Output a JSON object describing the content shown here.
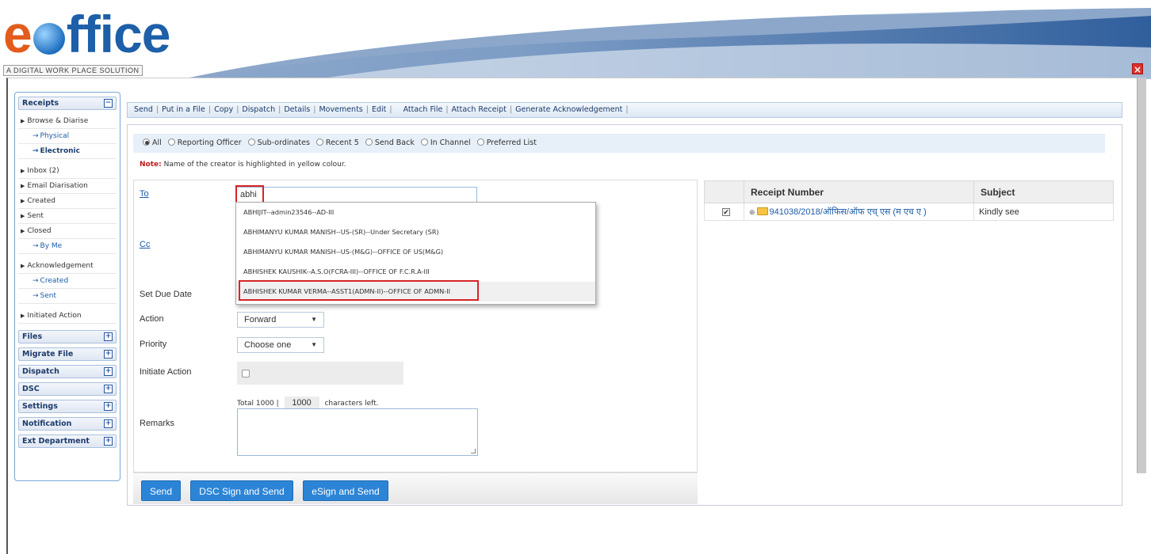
{
  "header": {
    "logo_e": "e",
    "logo_rest": "ffice",
    "tagline": "A DIGITAL WORK PLACE SOLUTION",
    "close": "×"
  },
  "sidebar": {
    "receipts": {
      "title": "Receipts",
      "toggle": "−"
    },
    "receipt_items": [
      {
        "label": "Browse & Diarise",
        "type": "parent"
      },
      {
        "label": "Physical",
        "type": "sub"
      },
      {
        "label": "Electronic",
        "type": "sub-active"
      },
      {
        "label": "Inbox (2)",
        "type": "parent"
      },
      {
        "label": "Email Diarisation",
        "type": "parent"
      },
      {
        "label": "Created",
        "type": "parent"
      },
      {
        "label": "Sent",
        "type": "parent"
      },
      {
        "label": "Closed",
        "type": "parent"
      },
      {
        "label": "By Me",
        "type": "sub"
      },
      {
        "label": "Acknowledgement",
        "type": "parent"
      },
      {
        "label": "Created",
        "type": "sub"
      },
      {
        "label": "Sent",
        "type": "sub"
      },
      {
        "label": "Initiated Action",
        "type": "parent"
      }
    ],
    "sections": [
      "Files",
      "Migrate File",
      "Dispatch",
      "DSC",
      "Settings",
      "Notification",
      "Ext Department"
    ],
    "section_toggle": "+"
  },
  "toolbar": {
    "items": [
      "Send",
      "Put in a File",
      "Copy",
      "Dispatch",
      "Details",
      "Movements",
      "Edit",
      "Attach File",
      "Attach Receipt",
      "Generate Acknowledgement"
    ]
  },
  "filter": {
    "options": [
      "All",
      "Reporting Officer",
      "Sub-ordinates",
      "Recent 5",
      "Send Back",
      "In Channel",
      "Preferred List"
    ],
    "selected": "All",
    "note_label": "Note:",
    "note_text": " Name of the creator is highlighted in yellow colour."
  },
  "form": {
    "to_label": "To",
    "to_value": "abhi",
    "cc_label": "Cc",
    "due_label": "Set Due Date",
    "action_label": "Action",
    "action_value": "Forward",
    "priority_label": "Priority",
    "priority_value": "Choose one",
    "initiate_label": "Initiate Action",
    "counter_prefix": "Total 1000 |",
    "counter_value": "1000",
    "counter_suffix": "characters left.",
    "remarks_label": "Remarks",
    "suggestions": [
      "ABHIJIT--admin23546--AD-III",
      "ABHIMANYU KUMAR MANISH--US-(SR)--Under Secretary (SR)",
      "ABHIMANYU KUMAR MANISH--US-(M&G)--OFFICE OF US(M&G)",
      "ABHISHEK KAUSHIK--A.S.O(FCRA-III)--OFFICE OF F.C.R.A-III",
      "ABHISHEK KUMAR VERMA--ASST1(ADMN-II)--OFFICE OF ADMN-II"
    ],
    "buttons": {
      "send": "Send",
      "dsc": "DSC Sign and Send",
      "esign": "eSign and Send"
    }
  },
  "receipts_table": {
    "headers": [
      "Receipt Number",
      "Subject"
    ],
    "rows": [
      {
        "number": "941038/2018/ऑफिस/ऑफ एच् एस (म एच ए )",
        "subject": "Kindly see"
      }
    ]
  },
  "colors": {
    "accent": "#2c84d6",
    "highlight": "#d62525",
    "logo_orange": "#e25c1d",
    "logo_blue": "#1d5fa8"
  }
}
